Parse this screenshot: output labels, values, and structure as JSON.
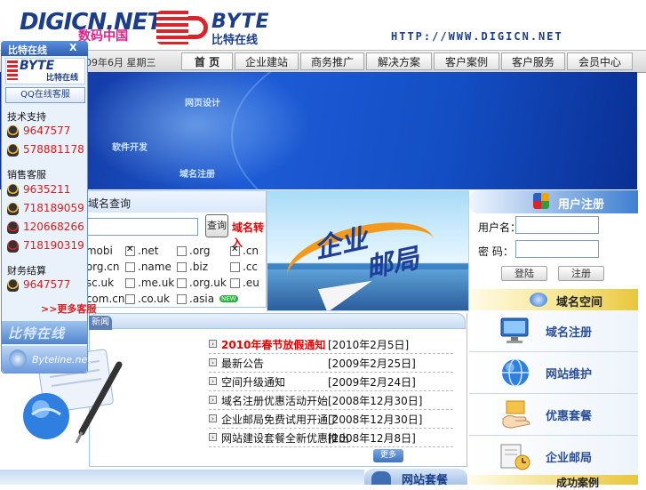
{
  "header": {
    "logo_main": "DIGICN.NET",
    "logo_cn": "数码中国",
    "byte_logo": "BYTE",
    "byte_sub": "比特在线",
    "url": "HTTP://WWW.DIGICN.NET"
  },
  "nav": {
    "date": "09年6月 星期三",
    "items": [
      "首 页",
      "企业建站",
      "商务推广",
      "解决方案",
      "客户案例",
      "客户服务",
      "会员中心"
    ]
  },
  "banner": {
    "tags": [
      "网页设计",
      "软件开发",
      "域名注册"
    ]
  },
  "domain": {
    "title": "域名查询",
    "search_button": "查询",
    "whois": "域名转入",
    "extensions": [
      {
        "label": ".mobi",
        "checked": false
      },
      {
        "label": ".net",
        "checked": true
      },
      {
        "label": ".org",
        "checked": false
      },
      {
        "label": ".cn",
        "checked": true
      },
      {
        "label": ".org.cn",
        "checked": false
      },
      {
        "label": ".name",
        "checked": false
      },
      {
        "label": ".biz",
        "checked": false
      },
      {
        "label": ".cc",
        "checked": false
      },
      {
        "label": ".sc.uk",
        "checked": false
      },
      {
        "label": ".me.uk",
        "checked": false
      },
      {
        "label": ".org.uk",
        "checked": false
      },
      {
        "label": ".eu",
        "checked": false
      },
      {
        "label": ".com.cn",
        "checked": false
      },
      {
        "label": ".co.uk",
        "checked": false
      },
      {
        "label": ".asia",
        "checked": false
      }
    ],
    "new_badge": "NEW"
  },
  "promo": {
    "text1": "企业",
    "text2": "邮局"
  },
  "news": {
    "tab_label": "新闻动态",
    "items": [
      {
        "title": "2010年春节放假通知",
        "date": "[2010年2月5日]",
        "hot": true
      },
      {
        "title": "最新公告",
        "date": "[2009年2月25日]",
        "hot": false
      },
      {
        "title": "空间升级通知",
        "date": "[2009年2月24日]",
        "hot": false
      },
      {
        "title": "域名注册优惠活动开始",
        "date": "[2008年12月30日]",
        "hot": false
      },
      {
        "title": "企业邮局免费试用开通了",
        "date": "[2008年12月30日]",
        "hot": false
      },
      {
        "title": "网站建设套餐全新优惠推出",
        "date": "[2008年12月8日]",
        "hot": false
      }
    ],
    "more": "更多"
  },
  "package": {
    "label": "网站套餐"
  },
  "register": {
    "title": "用户注册",
    "username_label": "用户名：",
    "password_label": "密 码：",
    "login_button": "登陆",
    "register_button": "注册"
  },
  "space": {
    "title": "域名空间"
  },
  "services": [
    {
      "label": "域名注册",
      "icon": "monitor-icon"
    },
    {
      "label": "网站维护",
      "icon": "globe-icon"
    },
    {
      "label": "优惠套餐",
      "icon": "hand-icon"
    },
    {
      "label": "企业邮局",
      "icon": "mail-clock-icon"
    }
  ],
  "cases": {
    "title": "成功案例"
  },
  "qq": {
    "title": "比特在线",
    "close": "X",
    "logo": "BYTE",
    "logo_sub": "比特在线",
    "online_label": "QQ在线客服",
    "groups": [
      {
        "name": "技术支持",
        "numbers": [
          {
            "num": "9647577",
            "color": "yellow"
          },
          {
            "num": "578881178",
            "color": "yellow"
          }
        ]
      },
      {
        "name": "销售客服",
        "numbers": [
          {
            "num": "9635211",
            "color": "yellow"
          },
          {
            "num": "718189059",
            "color": "yellow"
          },
          {
            "num": "120668266",
            "color": "red"
          },
          {
            "num": "718190319",
            "color": "red"
          }
        ]
      },
      {
        "name": "财务结算",
        "numbers": [
          {
            "num": "9647577",
            "color": "yellow"
          }
        ]
      }
    ],
    "more": ">>更多客服",
    "foot1": "比特在线",
    "foot2": "Byteline.net"
  }
}
